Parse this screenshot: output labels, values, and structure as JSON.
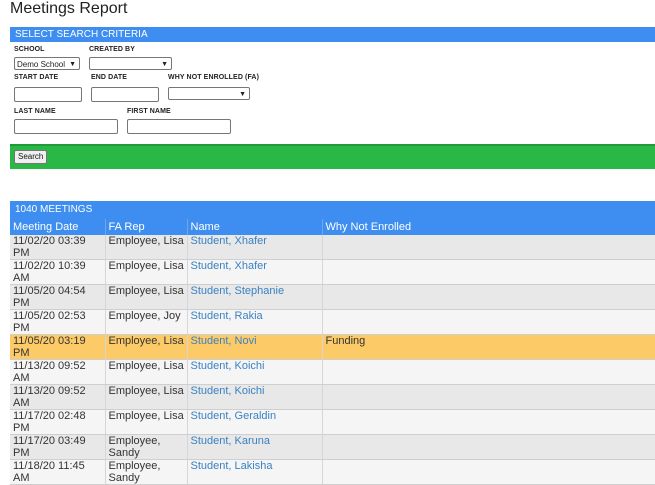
{
  "page": {
    "title": "Meetings Report"
  },
  "criteria": {
    "header": "SELECT SEARCH CRITERIA",
    "school_label": "SCHOOL",
    "school_value": "Demo School",
    "created_by_label": "CREATED BY",
    "created_by_value": "",
    "start_date_label": "START DATE",
    "end_date_label": "END DATE",
    "why_not_label": "WHY NOT ENROLLED (FA)",
    "why_not_value": "",
    "last_name_label": "LAST NAME",
    "first_name_label": "FIRST NAME",
    "search_button": "Search"
  },
  "results": {
    "header": "1040 MEETINGS",
    "columns": [
      "Meeting Date",
      "FA Rep",
      "Name",
      "Why Not Enrolled"
    ],
    "rows": [
      {
        "date": "11/02/20 03:39 PM",
        "rep": "Employee, Lisa",
        "name": "Student, Xhafer",
        "why": ""
      },
      {
        "date": "11/02/20 10:39 AM",
        "rep": "Employee, Lisa",
        "name": "Student, Xhafer",
        "why": ""
      },
      {
        "date": "11/05/20 04:54 PM",
        "rep": "Employee, Lisa",
        "name": "Student, Stephanie",
        "why": ""
      },
      {
        "date": "11/05/20 02:53 PM",
        "rep": "Employee, Joy",
        "name": "Student, Rakia",
        "why": ""
      },
      {
        "date": "11/05/20 03:19 PM",
        "rep": "Employee, Lisa",
        "name": "Student, Novi",
        "why": "Funding"
      },
      {
        "date": "11/13/20 09:52 AM",
        "rep": "Employee, Lisa",
        "name": "Student, Koichi",
        "why": ""
      },
      {
        "date": "11/13/20 09:52 AM",
        "rep": "Employee, Lisa",
        "name": "Student, Koichi",
        "why": ""
      },
      {
        "date": "11/17/20 02:48 PM",
        "rep": "Employee, Lisa",
        "name": "Student, Geraldin",
        "why": ""
      },
      {
        "date": "11/17/20 03:49 PM",
        "rep": "Employee, Sandy",
        "name": "Student, Karuna",
        "why": ""
      },
      {
        "date": "11/18/20 11:45 AM",
        "rep": "Employee, Sandy",
        "name": "Student, Lakisha",
        "why": ""
      }
    ],
    "highlight_color": "#fdca68"
  }
}
